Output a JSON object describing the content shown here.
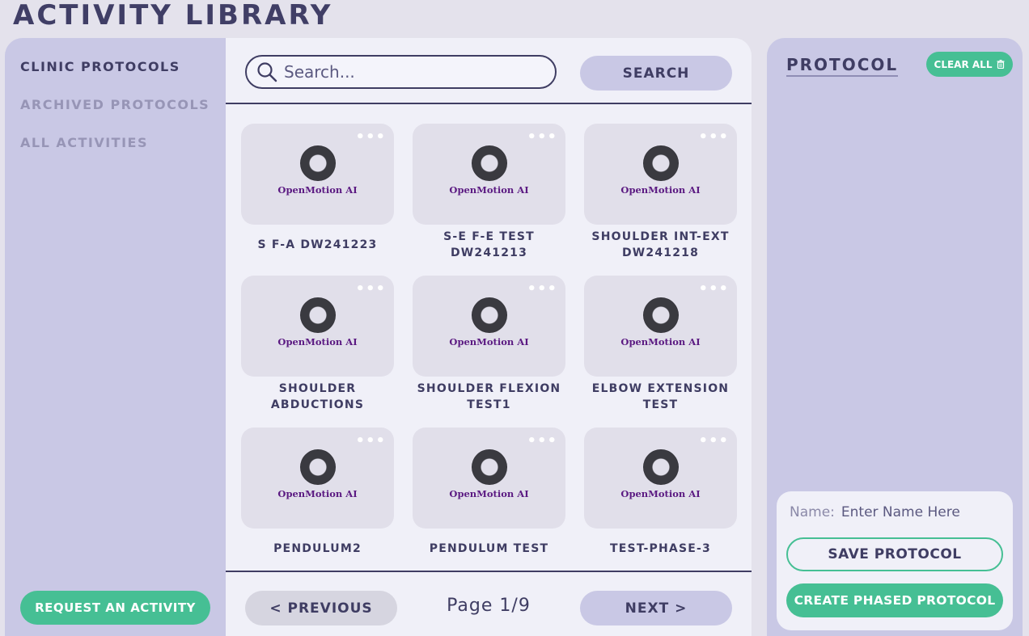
{
  "page_title": "ACTIVITY LIBRARY",
  "sidebar": {
    "items": [
      {
        "label": "CLINIC PROTOCOLS"
      },
      {
        "label": "ARCHIVED PROTOCOLS"
      },
      {
        "label": "ALL ACTIVITIES"
      }
    ],
    "request_label": "REQUEST AN ACTIVITY"
  },
  "search": {
    "placeholder": "Search...",
    "value": "",
    "button_label": "SEARCH",
    "icon": "search-icon"
  },
  "activities": [
    {
      "label": "S F-A DW241223",
      "logo_text": "OpenMotion AI"
    },
    {
      "label": "S-E F-E TEST DW241213",
      "logo_text": "OpenMotion AI"
    },
    {
      "label": "SHOULDER INT-EXT DW241218",
      "logo_text": "OpenMotion AI"
    },
    {
      "label": "SHOULDER ABDUCTIONS",
      "logo_text": "OpenMotion AI"
    },
    {
      "label": "SHOULDER FLEXION TEST1",
      "logo_text": "OpenMotion AI"
    },
    {
      "label": "ELBOW EXTENSION TEST",
      "logo_text": "OpenMotion AI"
    },
    {
      "label": "PENDULUM2",
      "logo_text": "OpenMotion AI"
    },
    {
      "label": "PENDULUM TEST",
      "logo_text": "OpenMotion AI"
    },
    {
      "label": "TEST-PHASE-3",
      "logo_text": "OpenMotion AI"
    }
  ],
  "pagination": {
    "prev_label": "< PREVIOUS",
    "next_label": "NEXT >",
    "page_text": "Page 1/9"
  },
  "protocol": {
    "title": "PROTOCOL",
    "clear_label": "CLEAR ALL",
    "name_label": "Name:",
    "name_placeholder": "Enter Name Here",
    "name_value": "",
    "save_label": "SAVE PROTOCOL",
    "phased_label": "CREATE PHASED PROTOCOL"
  },
  "colors": {
    "accent": "#46bf94",
    "text": "#3f3d63",
    "panel": "#c9c8e5",
    "background": "#e4e2ec"
  }
}
